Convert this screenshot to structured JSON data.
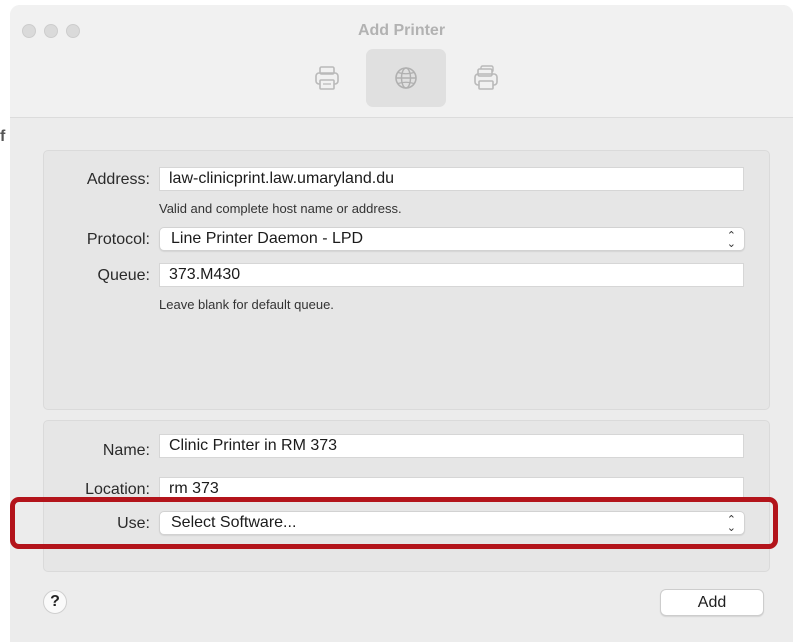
{
  "window": {
    "title": "Add Printer"
  },
  "toolbar": {
    "items": [
      {
        "name": "default-printers",
        "icon": "printer-icon",
        "selected": false
      },
      {
        "name": "ip-printers",
        "icon": "globe-icon",
        "selected": true
      },
      {
        "name": "windows-printers",
        "icon": "printer-stack-icon",
        "selected": false
      }
    ]
  },
  "address": {
    "label": "Address:",
    "value": "law-clinicprint.law.umaryland.du",
    "hint": "Valid and complete host name or address."
  },
  "protocol": {
    "label": "Protocol:",
    "value": "Line Printer Daemon - LPD"
  },
  "queue": {
    "label": "Queue:",
    "value": "373.M430",
    "hint": "Leave blank for default queue."
  },
  "name_field": {
    "label": "Name:",
    "value": "Clinic Printer in RM 373"
  },
  "location": {
    "label": "Location:",
    "value": "rm 373"
  },
  "use": {
    "label": "Use:",
    "value": "Select Software..."
  },
  "buttons": {
    "help": "?",
    "add": "Add"
  },
  "background": {
    "fragment": "f"
  },
  "colors": {
    "highlight": "#b3141b",
    "panel": "#e6e6e6",
    "window": "#ececec"
  }
}
